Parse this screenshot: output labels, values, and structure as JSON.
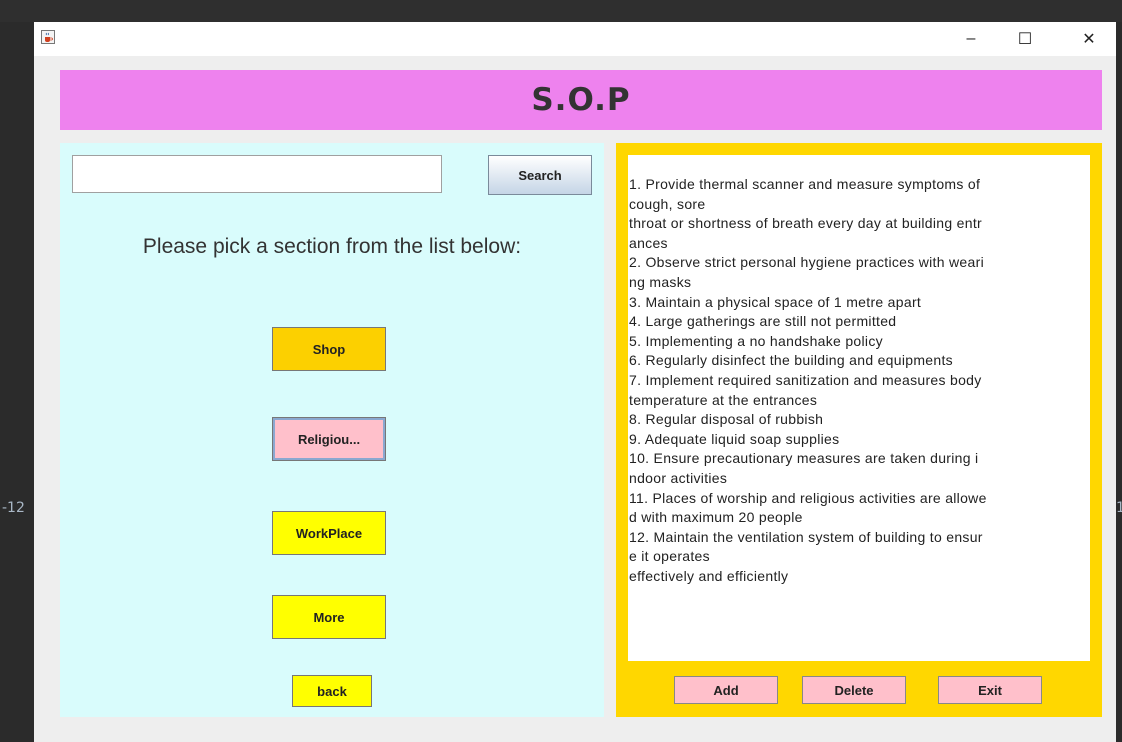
{
  "background": {
    "left_number": "-12"
  },
  "window": {
    "icons": {
      "app": "java-cup-icon",
      "minimize": "minimize-icon",
      "maximize": "maximize-icon",
      "close": "close-icon"
    },
    "controls": {
      "minimize": "–",
      "maximize": "☐",
      "close": "✕"
    }
  },
  "header": {
    "title": "S.O.P",
    "color": "#ee82ee"
  },
  "left_panel": {
    "background": "#d9fcfc",
    "search": {
      "value": "",
      "placeholder": "",
      "button_label": "Search"
    },
    "prompt": "Please pick a section from the list below:",
    "sections": [
      {
        "label": "Shop",
        "color": "#fcd000"
      },
      {
        "label": "Religiou...",
        "color": "#ffc0cb"
      },
      {
        "label": "WorkPlace",
        "color": "#ffff00"
      },
      {
        "label": "More",
        "color": "#ffff00"
      }
    ],
    "back_label": "back"
  },
  "right_panel": {
    "background": "#ffd700",
    "lines": [
      "1. Provide thermal scanner and measure symptoms of",
      "cough, sore",
      "throat or shortness of breath every day at building entr",
      "ances",
      "2. Observe strict personal hygiene practices with weari",
      "ng masks",
      "3. Maintain a physical space of 1 metre apart",
      "4. Large gatherings are still not permitted",
      "5. Implementing a no handshake policy",
      "6. Regularly disinfect the building and equipments",
      "7. Implement required sanitization and measures body",
      "temperature at the entrances",
      "8. Regular disposal of rubbish",
      "9. Adequate liquid soap supplies",
      "10. Ensure precautionary measures are taken during i",
      "ndoor activities",
      "11. Places of worship and religious activities are allowe",
      "d with maximum 20 people",
      "12. Maintain the ventilation system of building to ensur",
      "e it operates",
      "effectively and efficiently"
    ],
    "buttons": {
      "add": "Add",
      "delete": "Delete",
      "exit": "Exit"
    }
  }
}
